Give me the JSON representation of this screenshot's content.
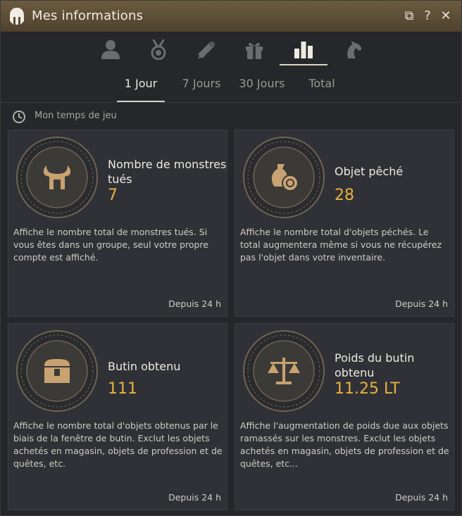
{
  "window": {
    "title": "Mes informations"
  },
  "title_buttons": {
    "restore": "⧉",
    "help": "?",
    "close": "✕"
  },
  "category_tabs": [
    {
      "icon": "user-icon"
    },
    {
      "icon": "medal-icon"
    },
    {
      "icon": "scroll-icon"
    },
    {
      "icon": "gift-icon"
    },
    {
      "icon": "stats-icon",
      "active": true
    },
    {
      "icon": "horse-icon"
    }
  ],
  "period_tabs": [
    "1 Jour",
    "7 Jours",
    "30 Jours",
    "Total"
  ],
  "section": {
    "label": "Mon temps de jeu"
  },
  "cards": [
    {
      "name": "Nombre de monstres tués",
      "value": "7",
      "desc": "Affiche le nombre total de monstres tués. Si vous êtes dans un groupe, seul votre propre compte est affiché.",
      "since": "Depuis 24 h",
      "icon": "helmet-icon"
    },
    {
      "name": "Objet pêché",
      "value": "28",
      "desc": "Affiche le nombre total d'objets péchés. Le total augmentera même si vous ne récupérez pas l'objet dans votre inventaire.",
      "since": "Depuis 24 h",
      "icon": "fish-bag-icon"
    },
    {
      "name": "Butin obtenu",
      "value": "111",
      "desc": "Affiche le nombre total d'objets obtenus par le biais de la fenêtre de butin. Exclut les objets achetés en magasin, objets de profession et de quêtes, etc.",
      "since": "Depuis 24 h",
      "icon": "chest-icon"
    },
    {
      "name": "Poids du butin obtenu",
      "value": "11.25 LT",
      "desc": "Affiche l'augmentation de poids due aux objets ramassés sur les monstres. Exclut les objets achetés en magasin, objets de profession et de quêtes, etc...",
      "since": "Depuis 24 h",
      "icon": "scale-icon"
    }
  ],
  "colors": {
    "accent_value": "#e8b13f",
    "titlebar": "#5a4c35",
    "card_bg": "#303136"
  }
}
